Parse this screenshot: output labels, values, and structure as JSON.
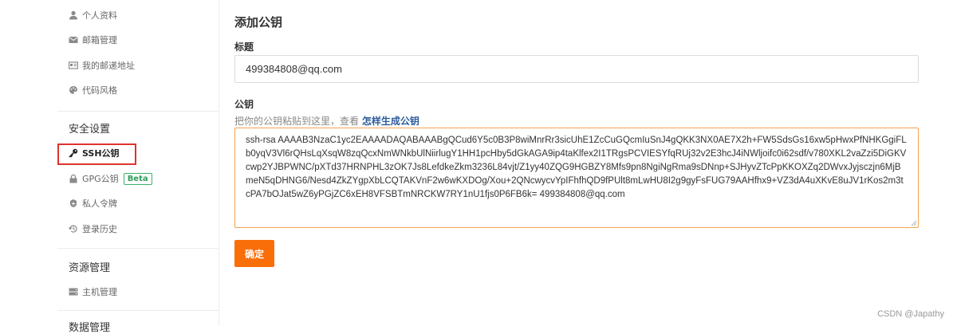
{
  "sidebar": {
    "items_top": [
      {
        "label": "个人资料",
        "icon": "user-icon"
      },
      {
        "label": "邮箱管理",
        "icon": "mail-icon"
      },
      {
        "label": "我的邮递地址",
        "icon": "address-card-icon"
      },
      {
        "label": "代码风格",
        "icon": "palette-icon"
      }
    ],
    "security_title": "安全设置",
    "security_items": [
      {
        "label": "SSH公钥",
        "icon": "key-icon",
        "active": true
      },
      {
        "label": "GPG公钥",
        "icon": "lock-icon",
        "badge": "Beta"
      },
      {
        "label": "私人令牌",
        "icon": "token-icon"
      },
      {
        "label": "登录历史",
        "icon": "history-icon"
      }
    ],
    "resource_title": "资源管理",
    "resource_items": [
      {
        "label": "主机管理",
        "icon": "server-icon"
      }
    ],
    "data_title_partial": "数据管理"
  },
  "main": {
    "page_title": "添加公钥",
    "title_label": "标题",
    "title_value": "499384808@qq.com",
    "key_label": "公钥",
    "help_prefix": "把你的公钥粘贴到这里，查看",
    "help_link": "怎样生成公钥",
    "key_value": "ssh-rsa AAAAB3NzaC1yc2EAAAADAQABAAABgQCud6Y5c0B3P8wiMnrRr3sicUhE1ZcCuGQcmIuSnJ4gQKK3NX0AE7X2h+FW5SdsGs16xw5pHwxPfNHKGgiFLb0yqV3Vl6rQHsLqXsqW8zqQcxNmWNkbUlNiirlugY1HH1pcHby5dGkAGA9ip4taKlfex2I1TRgsPCVIESYfqRUj32v2E3hcJ4iNWljoifc0i62sdf/v780XKL2vaZzi5DiGKVcwp2YJBPWNC/pXTd37HRNPHL3zOK7Js8LefdkeZkm3236L84vjt/Z1yy40ZQG9HGBZY8Mfs9pn8NgiNgRma9sDNnp+SJHyvZTcPpKKOXZq2DWvxJyjsczjn6MjBmeN5qDHNG6/Nesd4ZkZYgpXbLCQTAKVnF2w6wKXDOg/Xou+2QNcwycvYpIFhfhQD9fPUlt8mLwHU8I2g9gyFsFUG79AAHfhx9+VZ3dA4uXKvE8uJV1rKos2m3tcPA7bOJat5wZ6yPGjZC6xEH8VFSBTmNRCKW7RY1nU1fjs0P6FB6k= 499384808@qq.com",
    "confirm_label": "确定"
  },
  "watermark": "CSDN @Japathy",
  "colors": {
    "accent": "#fa6e0a",
    "key_border": "#f5a34c",
    "highlight": "#e0322f",
    "link": "#2b5c9b",
    "badge": "#3bb16a"
  }
}
